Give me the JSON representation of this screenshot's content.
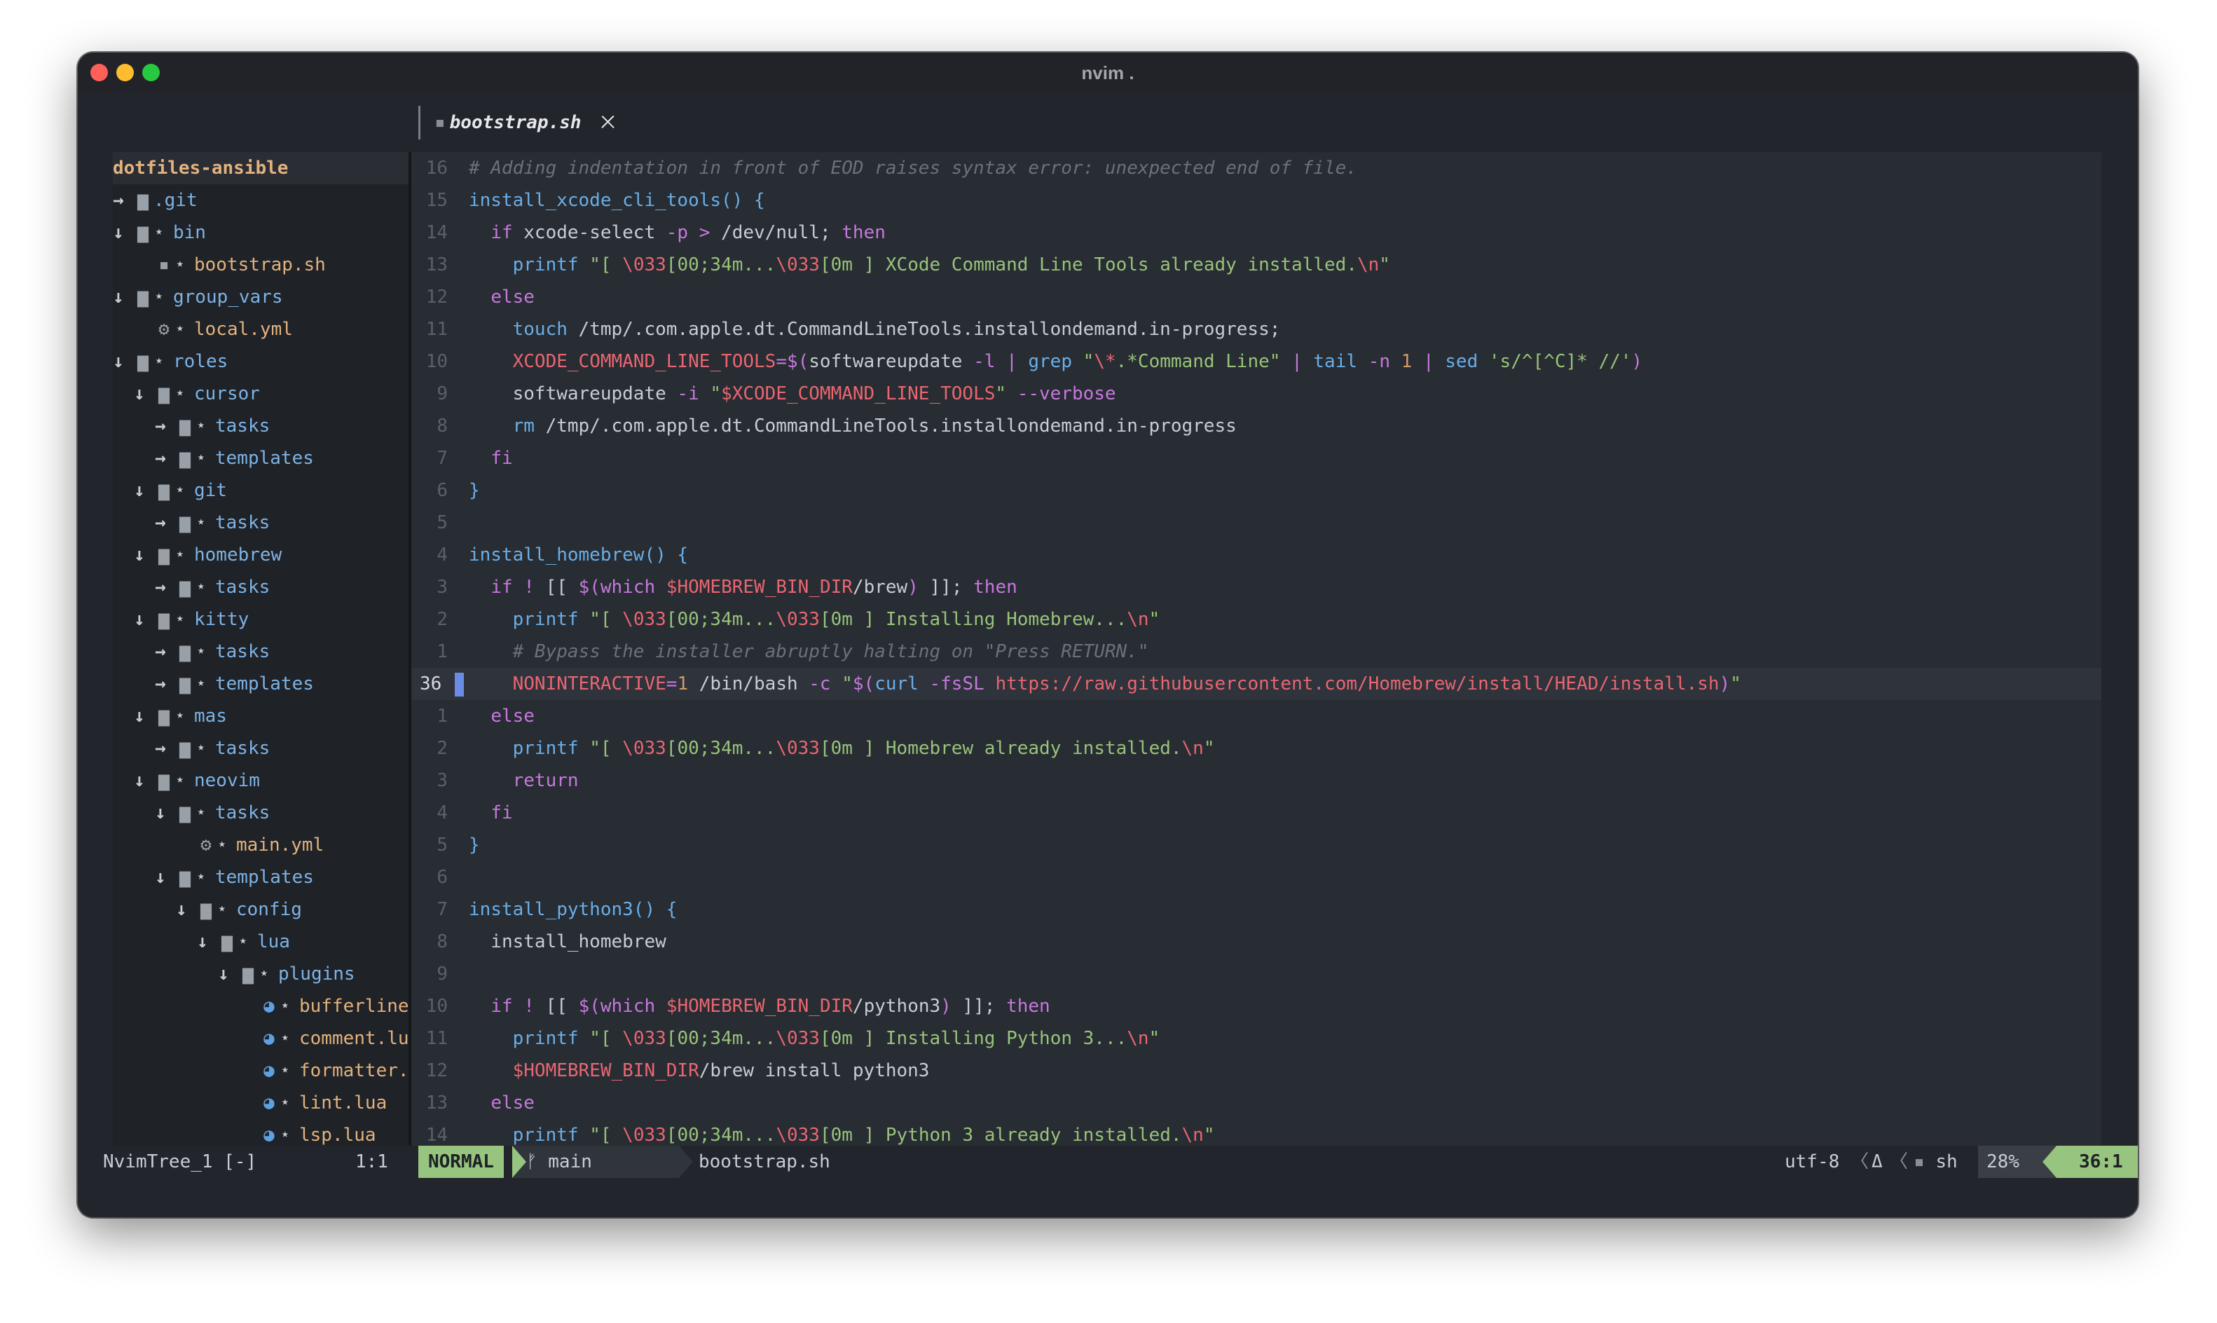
{
  "window": {
    "title": "nvim ."
  },
  "tab": {
    "label": "bootstrap.sh",
    "close": "🞩"
  },
  "sidebar": {
    "root": "dotfiles-ansible",
    "items": [
      {
        "indent": 0,
        "arrow": "→",
        "icon": "folder",
        "star": false,
        "name": ".git",
        "kind": "dir"
      },
      {
        "indent": 0,
        "arrow": "↓",
        "icon": "folder",
        "star": true,
        "name": "bin",
        "kind": "dir"
      },
      {
        "indent": 1,
        "arrow": "",
        "icon": "terminal",
        "star": true,
        "name": "bootstrap.sh",
        "kind": "file"
      },
      {
        "indent": 0,
        "arrow": "↓",
        "icon": "folder",
        "star": true,
        "name": "group_vars",
        "kind": "dir"
      },
      {
        "indent": 1,
        "arrow": "",
        "icon": "gear",
        "star": true,
        "name": "local.yml",
        "kind": "file"
      },
      {
        "indent": 0,
        "arrow": "↓",
        "icon": "folder",
        "star": true,
        "name": "roles",
        "kind": "dir"
      },
      {
        "indent": 1,
        "arrow": "↓",
        "icon": "folder",
        "star": true,
        "name": "cursor",
        "kind": "dir"
      },
      {
        "indent": 2,
        "arrow": "→",
        "icon": "folder",
        "star": true,
        "name": "tasks",
        "kind": "dir"
      },
      {
        "indent": 2,
        "arrow": "→",
        "icon": "folder",
        "star": true,
        "name": "templates",
        "kind": "dir"
      },
      {
        "indent": 1,
        "arrow": "↓",
        "icon": "folder",
        "star": true,
        "name": "git",
        "kind": "dir"
      },
      {
        "indent": 2,
        "arrow": "→",
        "icon": "folder",
        "star": true,
        "name": "tasks",
        "kind": "dir"
      },
      {
        "indent": 1,
        "arrow": "↓",
        "icon": "folder",
        "star": true,
        "name": "homebrew",
        "kind": "dir"
      },
      {
        "indent": 2,
        "arrow": "→",
        "icon": "folder",
        "star": true,
        "name": "tasks",
        "kind": "dir"
      },
      {
        "indent": 1,
        "arrow": "↓",
        "icon": "folder",
        "star": true,
        "name": "kitty",
        "kind": "dir"
      },
      {
        "indent": 2,
        "arrow": "→",
        "icon": "folder",
        "star": true,
        "name": "tasks",
        "kind": "dir"
      },
      {
        "indent": 2,
        "arrow": "→",
        "icon": "folder",
        "star": true,
        "name": "templates",
        "kind": "dir"
      },
      {
        "indent": 1,
        "arrow": "↓",
        "icon": "folder",
        "star": true,
        "name": "mas",
        "kind": "dir"
      },
      {
        "indent": 2,
        "arrow": "→",
        "icon": "folder",
        "star": true,
        "name": "tasks",
        "kind": "dir"
      },
      {
        "indent": 1,
        "arrow": "↓",
        "icon": "folder",
        "star": true,
        "name": "neovim",
        "kind": "dir"
      },
      {
        "indent": 2,
        "arrow": "↓",
        "icon": "folder",
        "star": true,
        "name": "tasks",
        "kind": "dir"
      },
      {
        "indent": 3,
        "arrow": "",
        "icon": "gear",
        "star": true,
        "name": "main.yml",
        "kind": "file"
      },
      {
        "indent": 2,
        "arrow": "↓",
        "icon": "folder",
        "star": true,
        "name": "templates",
        "kind": "dir"
      },
      {
        "indent": 3,
        "arrow": "↓",
        "icon": "folder",
        "star": true,
        "name": "config",
        "kind": "dir"
      },
      {
        "indent": 4,
        "arrow": "↓",
        "icon": "folder",
        "star": true,
        "name": "lua",
        "kind": "dir"
      },
      {
        "indent": 5,
        "arrow": "↓",
        "icon": "folder",
        "star": true,
        "name": "plugins",
        "kind": "dir"
      },
      {
        "indent": 6,
        "arrow": "",
        "icon": "lua",
        "star": true,
        "name": "bufferline",
        "kind": "file"
      },
      {
        "indent": 6,
        "arrow": "",
        "icon": "lua",
        "star": true,
        "name": "comment.lu",
        "kind": "file"
      },
      {
        "indent": 6,
        "arrow": "",
        "icon": "lua",
        "star": true,
        "name": "formatter.",
        "kind": "file"
      },
      {
        "indent": 6,
        "arrow": "",
        "icon": "lua",
        "star": true,
        "name": "lint.lua",
        "kind": "file"
      },
      {
        "indent": 6,
        "arrow": "",
        "icon": "lua",
        "star": true,
        "name": "lsp.lua",
        "kind": "file"
      }
    ]
  },
  "editor": {
    "cursor_line_index": 16,
    "lines": [
      {
        "n": "16",
        "segs": [
          [
            "com",
            "# Adding indentation in front of EOD raises syntax error: unexpected end of file."
          ]
        ]
      },
      {
        "n": "15",
        "segs": [
          [
            "fn",
            "install_xcode_cli_tools() {"
          ]
        ]
      },
      {
        "n": "14",
        "segs": [
          [
            "txt",
            "  "
          ],
          [
            "kw",
            "if"
          ],
          [
            "txt",
            " xcode-select "
          ],
          [
            "op",
            "-p"
          ],
          [
            "txt",
            " "
          ],
          [
            "op",
            ">"
          ],
          [
            "txt",
            " /dev/null; "
          ],
          [
            "kw",
            "then"
          ]
        ]
      },
      {
        "n": "13",
        "segs": [
          [
            "txt",
            "    "
          ],
          [
            "fn",
            "printf"
          ],
          [
            "txt",
            " "
          ],
          [
            "str",
            "\"[ "
          ],
          [
            "esc",
            "\\033"
          ],
          [
            "str",
            "[00;34m..."
          ],
          [
            "esc",
            "\\033"
          ],
          [
            "str",
            "[0m ] XCode Command Line Tools already installed."
          ],
          [
            "esc",
            "\\n"
          ],
          [
            "str",
            "\""
          ]
        ]
      },
      {
        "n": "12",
        "segs": [
          [
            "txt",
            "  "
          ],
          [
            "kw",
            "else"
          ]
        ]
      },
      {
        "n": "11",
        "segs": [
          [
            "txt",
            "    "
          ],
          [
            "fn",
            "touch"
          ],
          [
            "txt",
            " /tmp/.com.apple.dt.CommandLineTools.installondemand.in-progress;"
          ]
        ]
      },
      {
        "n": "10",
        "segs": [
          [
            "txt",
            "    "
          ],
          [
            "var",
            "XCODE_COMMAND_LINE_TOOLS"
          ],
          [
            "op",
            "=$("
          ],
          [
            "txt",
            "softwareupdate "
          ],
          [
            "op",
            "-l"
          ],
          [
            "txt",
            " "
          ],
          [
            "op",
            "|"
          ],
          [
            "txt",
            " "
          ],
          [
            "fn",
            "grep"
          ],
          [
            "txt",
            " "
          ],
          [
            "str",
            "\""
          ],
          [
            "esc",
            "\\*"
          ],
          [
            "str",
            ".*Command Line\""
          ],
          [
            "txt",
            " "
          ],
          [
            "op",
            "|"
          ],
          [
            "txt",
            " "
          ],
          [
            "fn",
            "tail"
          ],
          [
            "txt",
            " "
          ],
          [
            "op",
            "-n"
          ],
          [
            "txt",
            " "
          ],
          [
            "num",
            "1"
          ],
          [
            "txt",
            " "
          ],
          [
            "op",
            "|"
          ],
          [
            "txt",
            " "
          ],
          [
            "fn",
            "sed"
          ],
          [
            "txt",
            " "
          ],
          [
            "str",
            "'s/^[^C]* //'"
          ],
          [
            "op",
            ")"
          ]
        ]
      },
      {
        "n": "9",
        "segs": [
          [
            "txt",
            "    softwareupdate "
          ],
          [
            "op",
            "-i"
          ],
          [
            "txt",
            " "
          ],
          [
            "str",
            "\""
          ],
          [
            "var",
            "$XCODE_COMMAND_LINE_TOOLS"
          ],
          [
            "str",
            "\""
          ],
          [
            "txt",
            " "
          ],
          [
            "op",
            "--verbose"
          ]
        ]
      },
      {
        "n": "8",
        "segs": [
          [
            "txt",
            "    "
          ],
          [
            "fn",
            "rm"
          ],
          [
            "txt",
            " /tmp/.com.apple.dt.CommandLineTools.installondemand.in-progress"
          ]
        ]
      },
      {
        "n": "7",
        "segs": [
          [
            "txt",
            "  "
          ],
          [
            "kw",
            "fi"
          ]
        ]
      },
      {
        "n": "6",
        "segs": [
          [
            "fn",
            "}"
          ]
        ]
      },
      {
        "n": "5",
        "segs": []
      },
      {
        "n": "4",
        "segs": [
          [
            "fn",
            "install_homebrew() {"
          ]
        ]
      },
      {
        "n": "3",
        "segs": [
          [
            "txt",
            "  "
          ],
          [
            "kw",
            "if"
          ],
          [
            "txt",
            " "
          ],
          [
            "op",
            "!"
          ],
          [
            "txt",
            " [[ "
          ],
          [
            "op",
            "$("
          ],
          [
            "kw",
            "which"
          ],
          [
            "txt",
            " "
          ],
          [
            "var",
            "$HOMEBREW_BIN_DIR"
          ],
          [
            "txt",
            "/brew"
          ],
          [
            "op",
            ")"
          ],
          [
            "txt",
            " ]]; "
          ],
          [
            "kw",
            "then"
          ]
        ]
      },
      {
        "n": "2",
        "segs": [
          [
            "txt",
            "    "
          ],
          [
            "fn",
            "printf"
          ],
          [
            "txt",
            " "
          ],
          [
            "str",
            "\"[ "
          ],
          [
            "esc",
            "\\033"
          ],
          [
            "str",
            "[00;34m..."
          ],
          [
            "esc",
            "\\033"
          ],
          [
            "str",
            "[0m ] Installing Homebrew..."
          ],
          [
            "esc",
            "\\n"
          ],
          [
            "str",
            "\""
          ]
        ]
      },
      {
        "n": "1",
        "segs": [
          [
            "txt",
            "    "
          ],
          [
            "com",
            "# Bypass the installer abruptly halting on \"Press RETURN.\""
          ]
        ]
      },
      {
        "n": "36",
        "segs": [
          [
            "txt",
            "    "
          ],
          [
            "var",
            "NONINTERACTIVE"
          ],
          [
            "op",
            "="
          ],
          [
            "num",
            "1"
          ],
          [
            "txt",
            " /bin/bash "
          ],
          [
            "op",
            "-c"
          ],
          [
            "txt",
            " "
          ],
          [
            "str",
            "\""
          ],
          [
            "op",
            "$("
          ],
          [
            "fn",
            "curl"
          ],
          [
            "txt",
            " "
          ],
          [
            "op",
            "-fsSL"
          ],
          [
            "txt",
            " "
          ],
          [
            "url",
            "https://raw.githubusercontent.com/Homebrew/install/HEAD/install.sh"
          ],
          [
            "op",
            ")"
          ],
          [
            "str",
            "\""
          ]
        ]
      },
      {
        "n": "1",
        "segs": [
          [
            "txt",
            "  "
          ],
          [
            "kw",
            "else"
          ]
        ]
      },
      {
        "n": "2",
        "segs": [
          [
            "txt",
            "    "
          ],
          [
            "fn",
            "printf"
          ],
          [
            "txt",
            " "
          ],
          [
            "str",
            "\"[ "
          ],
          [
            "esc",
            "\\033"
          ],
          [
            "str",
            "[00;34m..."
          ],
          [
            "esc",
            "\\033"
          ],
          [
            "str",
            "[0m ] Homebrew already installed."
          ],
          [
            "esc",
            "\\n"
          ],
          [
            "str",
            "\""
          ]
        ]
      },
      {
        "n": "3",
        "segs": [
          [
            "txt",
            "    "
          ],
          [
            "kw",
            "return"
          ]
        ]
      },
      {
        "n": "4",
        "segs": [
          [
            "txt",
            "  "
          ],
          [
            "kw",
            "fi"
          ]
        ]
      },
      {
        "n": "5",
        "segs": [
          [
            "fn",
            "}"
          ]
        ]
      },
      {
        "n": "6",
        "segs": []
      },
      {
        "n": "7",
        "segs": [
          [
            "fn",
            "install_python3() {"
          ]
        ]
      },
      {
        "n": "8",
        "segs": [
          [
            "txt",
            "  install_homebrew"
          ]
        ]
      },
      {
        "n": "9",
        "segs": []
      },
      {
        "n": "10",
        "segs": [
          [
            "txt",
            "  "
          ],
          [
            "kw",
            "if"
          ],
          [
            "txt",
            " "
          ],
          [
            "op",
            "!"
          ],
          [
            "txt",
            " [[ "
          ],
          [
            "op",
            "$("
          ],
          [
            "kw",
            "which"
          ],
          [
            "txt",
            " "
          ],
          [
            "var",
            "$HOMEBREW_BIN_DIR"
          ],
          [
            "txt",
            "/python3"
          ],
          [
            "op",
            ")"
          ],
          [
            "txt",
            " ]]; "
          ],
          [
            "kw",
            "then"
          ]
        ]
      },
      {
        "n": "11",
        "segs": [
          [
            "txt",
            "    "
          ],
          [
            "fn",
            "printf"
          ],
          [
            "txt",
            " "
          ],
          [
            "str",
            "\"[ "
          ],
          [
            "esc",
            "\\033"
          ],
          [
            "str",
            "[00;34m..."
          ],
          [
            "esc",
            "\\033"
          ],
          [
            "str",
            "[0m ] Installing Python 3..."
          ],
          [
            "esc",
            "\\n"
          ],
          [
            "str",
            "\""
          ]
        ]
      },
      {
        "n": "12",
        "segs": [
          [
            "txt",
            "    "
          ],
          [
            "var",
            "$HOMEBREW_BIN_DIR"
          ],
          [
            "txt",
            "/brew install python3"
          ]
        ]
      },
      {
        "n": "13",
        "segs": [
          [
            "txt",
            "  "
          ],
          [
            "kw",
            "else"
          ]
        ]
      },
      {
        "n": "14",
        "segs": [
          [
            "txt",
            "    "
          ],
          [
            "fn",
            "printf"
          ],
          [
            "txt",
            " "
          ],
          [
            "str",
            "\"[ "
          ],
          [
            "esc",
            "\\033"
          ],
          [
            "str",
            "[00;34m..."
          ],
          [
            "esc",
            "\\033"
          ],
          [
            "str",
            "[0m ] Python 3 already installed."
          ],
          [
            "esc",
            "\\n"
          ],
          [
            "str",
            "\""
          ]
        ]
      }
    ]
  },
  "statusline": {
    "tree_name": "NvimTree_1 [-]",
    "tree_pos": "1:1",
    "mode": "NORMAL",
    "branch_icon": "ᚠ",
    "branch": "main",
    "file": "bootstrap.sh",
    "encoding": "utf-8",
    "os_icon": "Δ",
    "filetype": "sh",
    "percent": "28%",
    "position": "36:1"
  }
}
